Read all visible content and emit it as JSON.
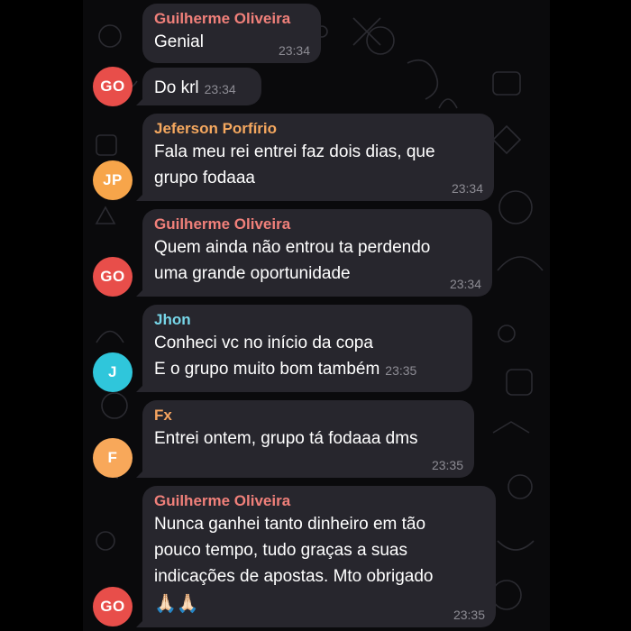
{
  "colors": {
    "background": "#000000",
    "bubble": "#27262d",
    "time": "#8d8c94",
    "name_guilherme": "#f0807a",
    "name_jeferson": "#f5a85f",
    "name_jhon": "#77d6e8",
    "name_fx": "#f7a560",
    "avatar_red": "#e84e4a",
    "avatar_orange": "#f7a54a",
    "avatar_cyan": "#2fc6db",
    "avatar_orange2": "#f8a85a"
  },
  "messages": [
    {
      "sender": "Guilherme Oliveira",
      "lines": [
        "Genial"
      ],
      "time": "23:34"
    },
    {
      "lines": [
        "Do krl"
      ],
      "time": "23:34",
      "avatar": "GO"
    },
    {
      "sender": "Jeferson Porfírio",
      "lines": [
        "Fala meu rei entrei faz dois dias, que",
        "grupo fodaaa"
      ],
      "time": "23:34",
      "avatar": "JP"
    },
    {
      "sender": "Guilherme Oliveira",
      "lines": [
        "Quem ainda não entrou ta perdendo",
        "uma grande oportunidade"
      ],
      "time": "23:34",
      "avatar": "GO"
    },
    {
      "sender": "Jhon",
      "lines": [
        "Conheci vc no início da copa",
        "E o grupo muito bom também"
      ],
      "time": "23:35",
      "avatar": "J"
    },
    {
      "sender": "Fx",
      "lines": [
        "Entrei ontem, grupo tá fodaaa dms"
      ],
      "time": "23:35",
      "avatar": "F"
    },
    {
      "sender": "Guilherme Oliveira",
      "lines": [
        "Nunca ganhei tanto dinheiro em tão",
        "pouco tempo, tudo graças a suas",
        "indicações de apostas. Mto obrigado"
      ],
      "emoji": "🙏🏻🙏🏻",
      "time": "23:35",
      "avatar": "GO"
    }
  ]
}
